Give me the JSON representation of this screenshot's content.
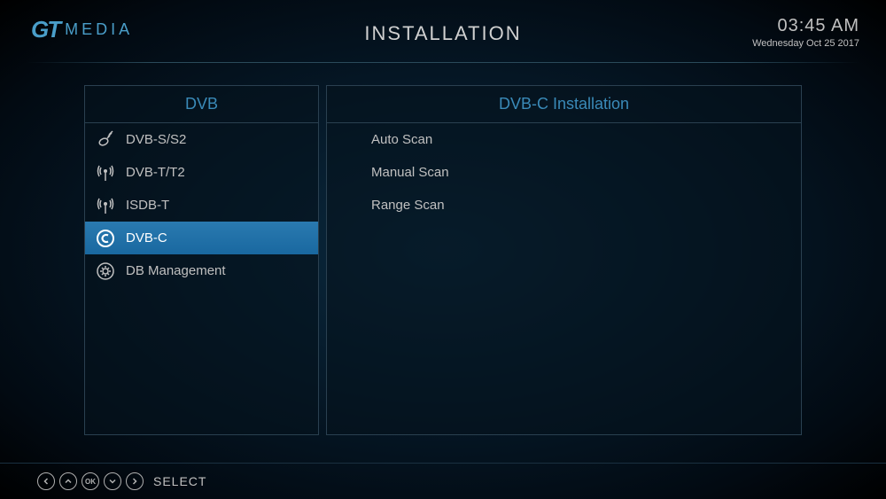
{
  "header": {
    "logo_gt": "GT",
    "logo_media": "MEDIA",
    "title": "INSTALLATION",
    "time": "03:45 AM",
    "date": "Wednesday Oct 25 2017"
  },
  "left_panel": {
    "title": "DVB",
    "items": [
      {
        "label": "DVB-S/S2",
        "selected": false
      },
      {
        "label": "DVB-T/T2",
        "selected": false
      },
      {
        "label": "ISDB-T",
        "selected": false
      },
      {
        "label": "DVB-C",
        "selected": true
      },
      {
        "label": "DB Management",
        "selected": false
      }
    ]
  },
  "right_panel": {
    "title": "DVB-C Installation",
    "items": [
      {
        "label": "Auto Scan"
      },
      {
        "label": "Manual Scan"
      },
      {
        "label": "Range Scan"
      }
    ]
  },
  "footer": {
    "ok": "OK",
    "select": "SELECT"
  }
}
